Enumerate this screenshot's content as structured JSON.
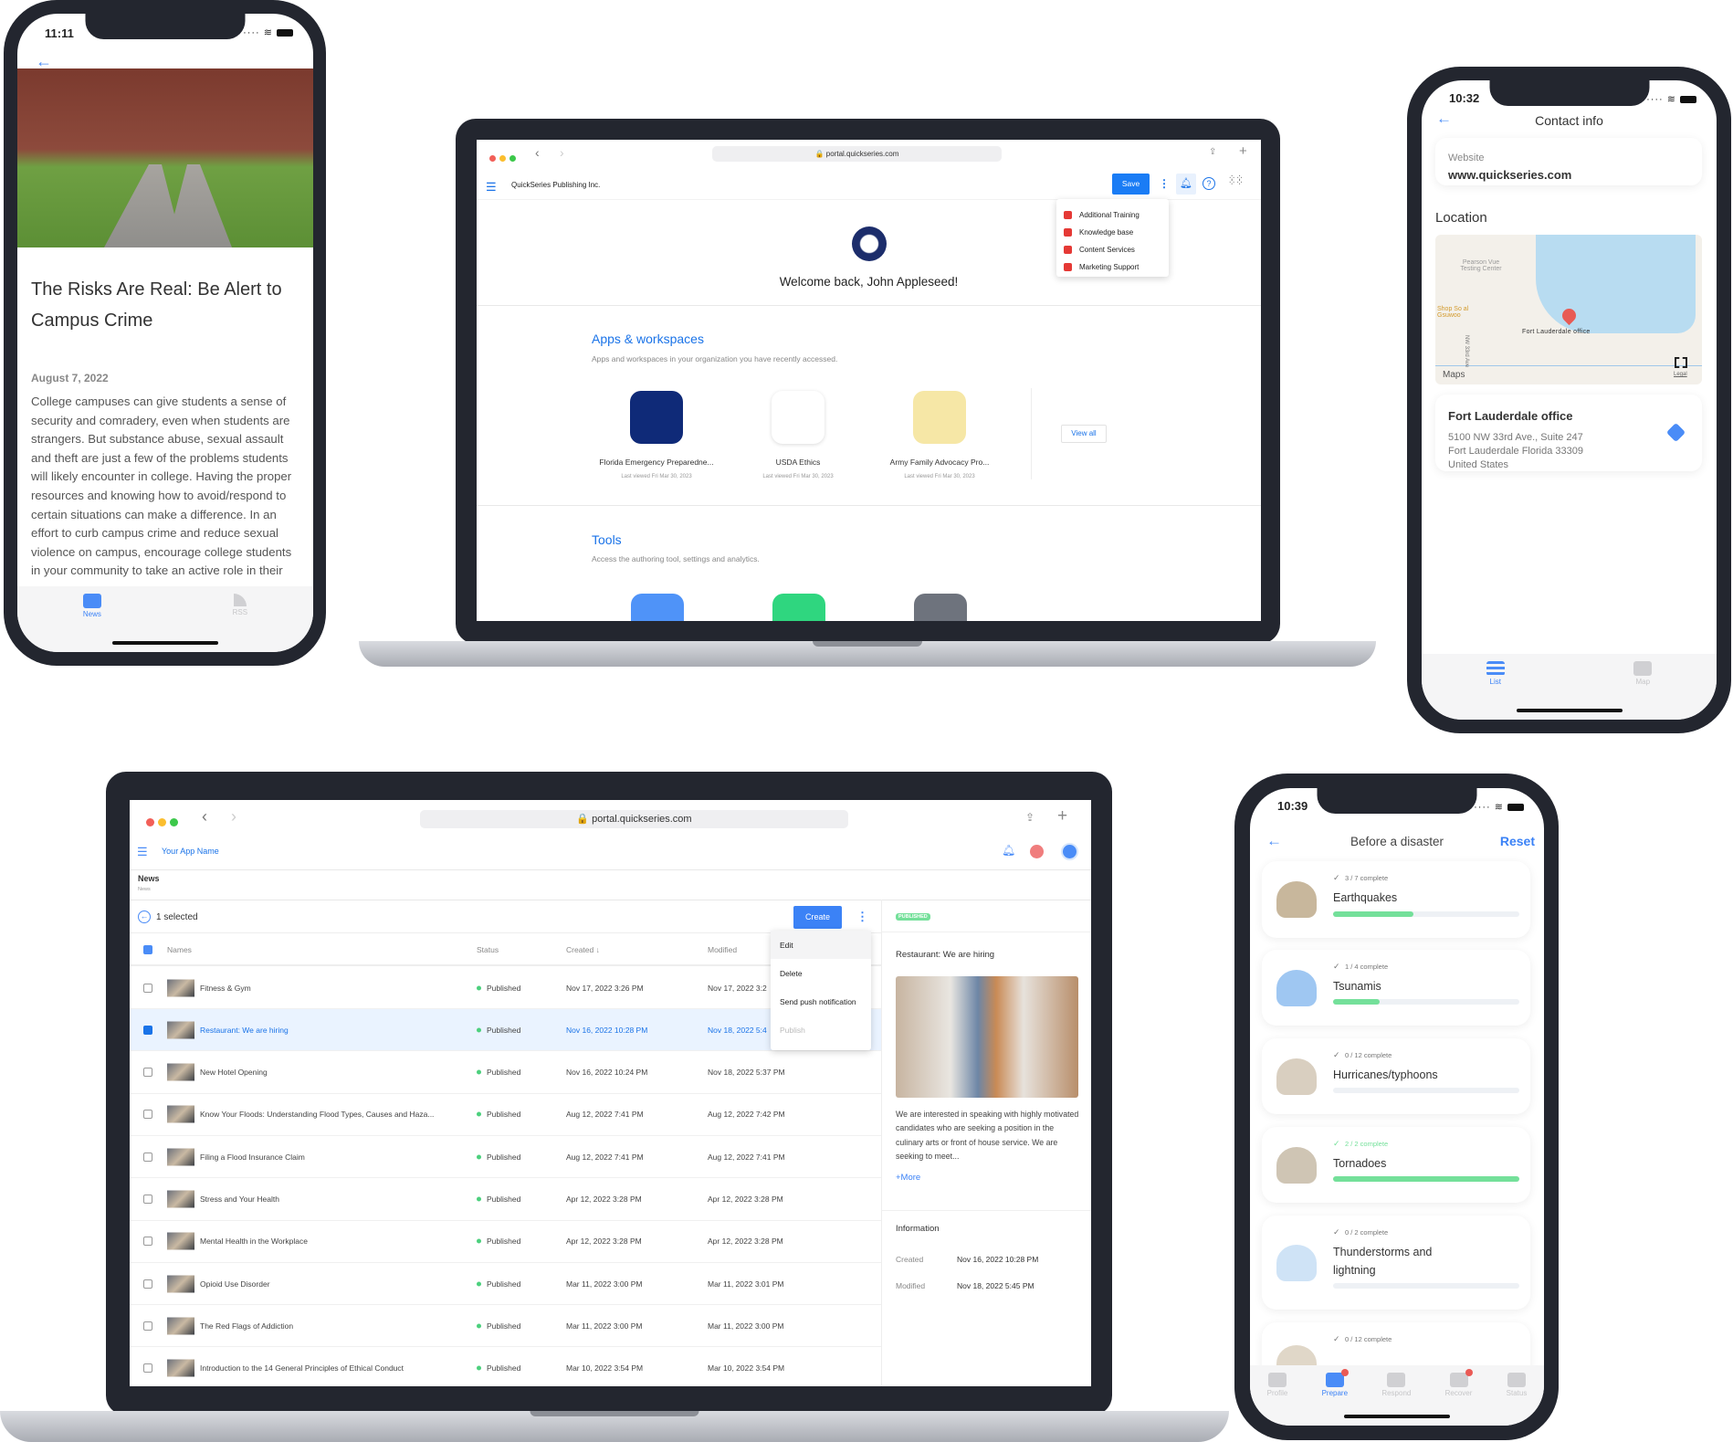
{
  "phone_news": {
    "time": "11:11",
    "article_title": "The Risks Are Real: Be Alert to Campus Crime",
    "date": "August 7, 2022",
    "body": "College campuses can give students a sense of security and comradery, even when students are strangers. But substance abuse, sexual assault and theft are just a few of the problems students will likely encounter in college. Having the proper resources and knowing how to avoid/respond to certain situations can make a difference. In an effort to curb campus crime and reduce sexual violence on campus, encourage college students in your community to take an active role in their own personal",
    "tabs": [
      {
        "label": "News",
        "icon": "news-icon",
        "active": true
      },
      {
        "label": "RSS",
        "icon": "rss-icon",
        "active": false
      }
    ]
  },
  "portal_home": {
    "url": "portal.quickseries.com",
    "org_name": "QuickSeries Publishing Inc.",
    "save_label": "Save",
    "menu": [
      {
        "label": "Additional Training"
      },
      {
        "label": "Knowledge base"
      },
      {
        "label": "Content Services"
      },
      {
        "label": "Marketing Support"
      }
    ],
    "welcome": "Welcome back, John Appleseed!",
    "apps_heading": "Apps & workspaces",
    "apps_subtitle": "Apps and workspaces in your organization you have recently accessed.",
    "apps": [
      {
        "name": "Florida Emergency Preparedne...",
        "last_viewed": "Last viewed Fri Mar 30, 2023",
        "color": "#0f2a78"
      },
      {
        "name": "USDA Ethics",
        "last_viewed": "Last viewed Fri Mar 30, 2023",
        "color": "#ffffff"
      },
      {
        "name": "Army Family Advocacy Pro...",
        "last_viewed": "Last viewed Fri Mar 30, 2023",
        "color": "#f6e7a6"
      }
    ],
    "view_all": "View all",
    "tools_heading": "Tools",
    "tools_subtitle": "Access the authoring tool, settings and analytics.",
    "tools": [
      {
        "icon": "rocket-icon",
        "color": "#4f93f8"
      },
      {
        "icon": "analytics-icon",
        "color": "#2fd67f"
      },
      {
        "icon": "settings-gear-icon",
        "color": "#6e737d"
      }
    ]
  },
  "phone_contact": {
    "time": "10:32",
    "title": "Contact info",
    "website_label": "Website",
    "website": "www.quickseries.com",
    "location_heading": "Location",
    "map": {
      "poi1": "Pearson Vue Testing Center",
      "poi2": "Shop So al Gsuwoo",
      "street": "NW 33rd Ave",
      "pin_label": "Fort Lauderdale office",
      "maps_brand": "Maps",
      "legal": "Legal"
    },
    "office_name": "Fort Lauderdale office",
    "address_line1": "5100 NW 33rd Ave., Suite 247",
    "address_line2": "Fort Lauderdale Florida  33309",
    "address_line3": "United States",
    "tabs": [
      {
        "label": "List",
        "active": true
      },
      {
        "label": "Map",
        "active": false
      }
    ]
  },
  "portal_news": {
    "url": "portal.quickseries.com",
    "app_name": "Your App Name",
    "page_title": "News",
    "breadcrumb": "News",
    "selected_text": "1 selected",
    "create_label": "Create",
    "columns": {
      "names": "Names",
      "status": "Status",
      "created": "Created",
      "modified": "Modified"
    },
    "row_menu": [
      {
        "label": "Edit",
        "disabled": false
      },
      {
        "label": "Delete",
        "disabled": false
      },
      {
        "label": "Send push notification",
        "disabled": false
      },
      {
        "label": "Publish",
        "disabled": true
      }
    ],
    "rows": [
      {
        "name": "Fitness & Gym",
        "status": "Published",
        "created": "Nov 17, 2022 3:26 PM",
        "modified": "Nov 17, 2022 3:2",
        "selected": false
      },
      {
        "name": "Restaurant: We are hiring",
        "status": "Published",
        "created": "Nov 16, 2022 10:28 PM",
        "modified": "Nov 18, 2022 5:4",
        "selected": true
      },
      {
        "name": "New Hotel Opening",
        "status": "Published",
        "created": "Nov 16, 2022 10:24 PM",
        "modified": "Nov 18, 2022 5:37 PM",
        "selected": false
      },
      {
        "name": "Know Your Floods: Understanding Flood Types, Causes and Haza...",
        "status": "Published",
        "created": "Aug 12, 2022 7:41 PM",
        "modified": "Aug 12, 2022 7:42 PM",
        "selected": false
      },
      {
        "name": "Filing a Flood Insurance Claim",
        "status": "Published",
        "created": "Aug 12, 2022 7:41 PM",
        "modified": "Aug 12, 2022 7:41 PM",
        "selected": false
      },
      {
        "name": "Stress and Your Health",
        "status": "Published",
        "created": "Apr 12, 2022 3:28 PM",
        "modified": "Apr 12, 2022 3:28 PM",
        "selected": false
      },
      {
        "name": "Mental Health in the Workplace",
        "status": "Published",
        "created": "Apr 12, 2022 3:28 PM",
        "modified": "Apr 12, 2022 3:28 PM",
        "selected": false
      },
      {
        "name": "Opioid Use Disorder",
        "status": "Published",
        "created": "Mar 11, 2022 3:00 PM",
        "modified": "Mar 11, 2022 3:01 PM",
        "selected": false
      },
      {
        "name": "The Red Flags of Addiction",
        "status": "Published",
        "created": "Mar 11, 2022 3:00 PM",
        "modified": "Mar 11, 2022 3:00 PM",
        "selected": false
      },
      {
        "name": "Introduction to the 14 General Principles of Ethical Conduct",
        "status": "Published",
        "created": "Mar 10, 2022 3:54 PM",
        "modified": "Mar 10, 2022 3:54 PM",
        "selected": false
      }
    ],
    "detail": {
      "badge": "PUBLISHED",
      "title": "Restaurant: We are hiring",
      "text": "We are interested in speaking with highly motivated candidates who are seeking a position in the culinary arts or front of house service. We are seeking to meet...",
      "more": "+More",
      "info_heading": "Information",
      "created_label": "Created",
      "created": "Nov 16, 2022 10:28 PM",
      "modified_label": "Modified",
      "modified": "Nov 18, 2022 5:45 PM"
    }
  },
  "phone_disaster": {
    "time": "10:39",
    "title": "Before a disaster",
    "reset": "Reset",
    "cards": [
      {
        "progress_text": "3 / 7 complete",
        "title": "Earthquakes",
        "progress": 0.43
      },
      {
        "progress_text": "1 / 4 complete",
        "title": "Tsunamis",
        "progress": 0.25
      },
      {
        "progress_text": "0 / 12 complete",
        "title": "Hurricanes/typhoons",
        "progress": 0
      },
      {
        "progress_text": "2 / 2 complete",
        "title": "Tornadoes",
        "progress": 1
      },
      {
        "progress_text": "0 / 2 complete",
        "title": "Thunderstorms and lightning",
        "progress": 0
      },
      {
        "progress_text": "0 / 12 complete",
        "title": "",
        "progress": 0
      }
    ],
    "tabs": [
      {
        "label": "Profile",
        "active": false,
        "badge": false
      },
      {
        "label": "Prepare",
        "active": true,
        "badge": true
      },
      {
        "label": "Respond",
        "active": false,
        "badge": false
      },
      {
        "label": "Recover",
        "active": false,
        "badge": true
      },
      {
        "label": "Status",
        "active": false,
        "badge": false
      }
    ]
  },
  "colors": {
    "accent": "#1a73e8",
    "success": "#74e09a",
    "menu_icon": "#e53935",
    "device": "#23262f"
  }
}
